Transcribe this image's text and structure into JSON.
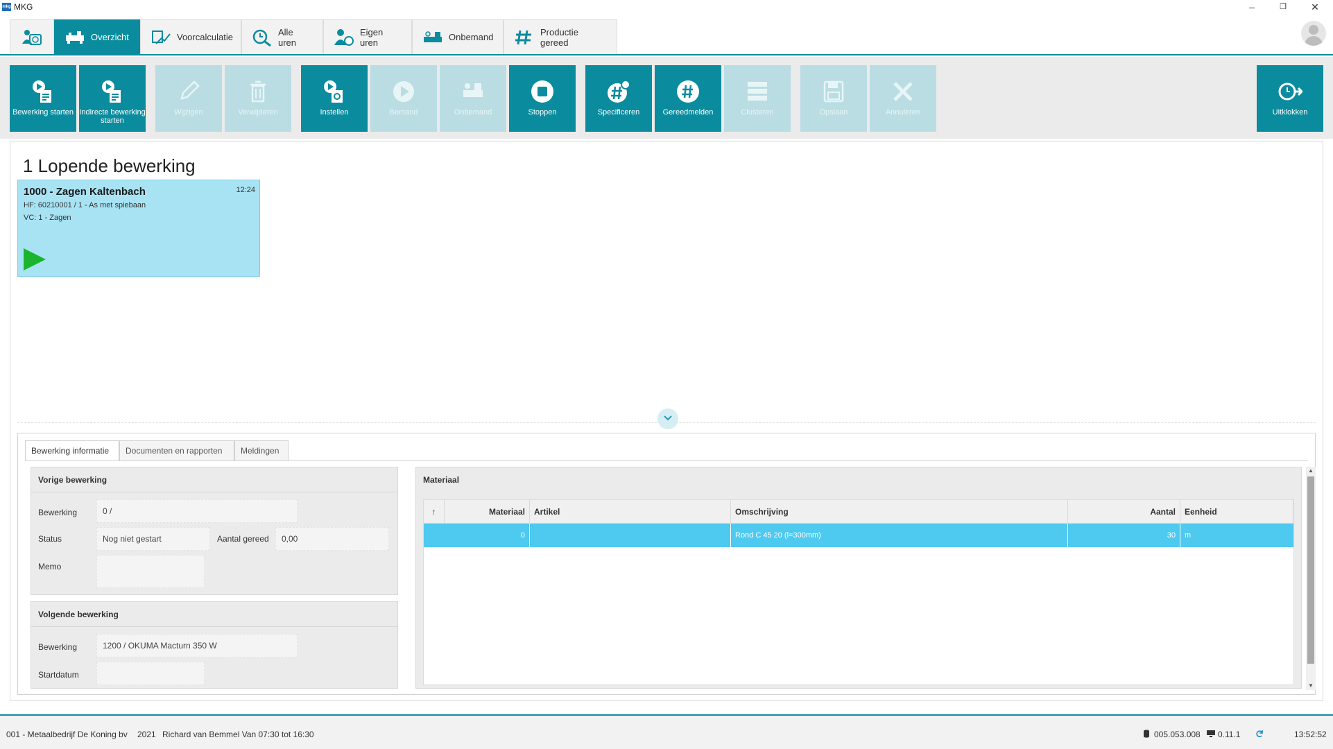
{
  "window": {
    "app_title": "MKG",
    "logo_text": "mkg"
  },
  "nav": {
    "tabs": [
      {
        "label": "",
        "icon": "clock-user-icon"
      },
      {
        "label": "Overzicht",
        "icon": "machine-icon"
      },
      {
        "label": "Voorcalculatie",
        "icon": "calculation-icon"
      },
      {
        "label": "Alle uren",
        "icon": "search-hours-icon"
      },
      {
        "label": "Eigen uren",
        "icon": "user-hours-icon"
      },
      {
        "label": "Onbemand",
        "icon": "machine-unmanned-icon"
      },
      {
        "label": "Productie gereed",
        "icon": "hash-ready-icon"
      }
    ]
  },
  "toolbar": {
    "buttons": [
      {
        "label": "Bewerking starten",
        "icon": "play-document-icon",
        "enabled": true
      },
      {
        "label": "Indirecte bewerking starten",
        "icon": "play-document-icon",
        "enabled": true
      },
      {
        "label": "Wijzigen",
        "icon": "pencil-icon",
        "enabled": false
      },
      {
        "label": "Verwijderen",
        "icon": "trash-icon",
        "enabled": false
      },
      {
        "label": "Instellen",
        "icon": "settings-document-icon",
        "enabled": true
      },
      {
        "label": "Bemand",
        "icon": "play-circle-icon",
        "enabled": false
      },
      {
        "label": "Onbemand",
        "icon": "machine-icon",
        "enabled": false
      },
      {
        "label": "Stoppen",
        "icon": "stop-icon",
        "enabled": true
      },
      {
        "label": "Specificeren",
        "icon": "hash-spec-icon",
        "enabled": true
      },
      {
        "label": "Gereedmelden",
        "icon": "hash-icon",
        "enabled": true
      },
      {
        "label": "Clusteren",
        "icon": "cluster-icon",
        "enabled": false
      },
      {
        "label": "Opslaan",
        "icon": "save-icon",
        "enabled": false
      },
      {
        "label": "Annuleren",
        "icon": "cancel-icon",
        "enabled": false
      },
      {
        "label": "Uitklokken",
        "icon": "clock-out-icon",
        "enabled": true
      }
    ]
  },
  "main": {
    "title": "1 Lopende bewerking",
    "card": {
      "title": "1000 - Zagen Kaltenbach",
      "time": "12:24",
      "line1": "HF: 60210001 / 1 - As met spiebaan",
      "line2": "VC: 1 - Zagen"
    }
  },
  "details": {
    "tabs": [
      "Bewerking informatie",
      "Documenten en rapporten",
      "Meldingen"
    ],
    "vorige": {
      "title": "Vorige bewerking",
      "bewerking_label": "Bewerking",
      "bewerking_value": "0 /",
      "status_label": "Status",
      "status_value": "Nog niet gestart",
      "aantal_label": "Aantal gereed",
      "aantal_value": "0,00",
      "memo_label": "Memo",
      "memo_value": ""
    },
    "volgende": {
      "title": "Volgende bewerking",
      "bewerking_label": "Bewerking",
      "bewerking_value": "1200 / OKUMA Macturn 350 W",
      "startdatum_label": "Startdatum",
      "startdatum_value": ""
    },
    "materiaal": {
      "title": "Materiaal",
      "sort_indicator": "↑",
      "columns": [
        "Materiaal",
        "Artikel",
        "Omschrijving",
        "Aantal",
        "Eenheid"
      ],
      "rows": [
        {
          "materiaal": "0",
          "artikel": "",
          "omschrijving": "Rond C 45 20 (l=300mm)",
          "aantal": "30",
          "eenheid": "m"
        }
      ]
    }
  },
  "statusbar": {
    "company": "001 - Metaalbedrijf De Koning bv",
    "year": "2021",
    "user": "Richard van Bemmel Van 07:30 tot 16:30",
    "db_version": "005.053.008",
    "app_version": "0.11.1",
    "time": "13:52:52"
  }
}
